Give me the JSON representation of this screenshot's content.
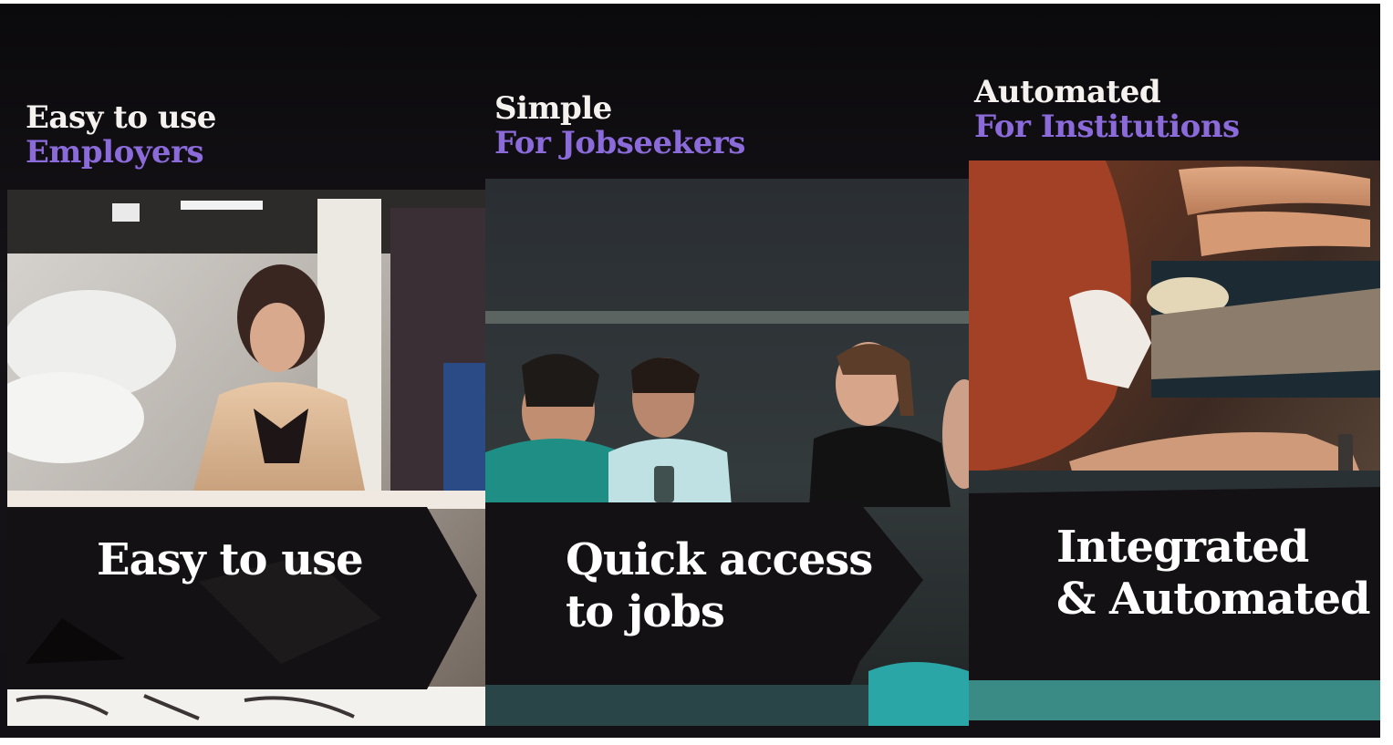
{
  "columns": [
    {
      "heading": "Easy to use",
      "audience": "Employers",
      "caption_lines": [
        "Easy to use"
      ]
    },
    {
      "heading": "Simple",
      "audience": "For Jobseekers",
      "caption_lines": [
        "Quick access",
        "to jobs"
      ]
    },
    {
      "heading": "Automated",
      "audience": "For Institutions",
      "caption_lines": [
        "Integrated",
        "& Automated"
      ]
    }
  ],
  "colors": {
    "heading": "#f4f1ee",
    "audience": "#8b6ad9",
    "background": "#141216",
    "caption_band": "#141114"
  },
  "photos": [
    {
      "subject": "woman-working-at-sewing-table-photo"
    },
    {
      "subject": "group-of-young-people-talking-photo"
    },
    {
      "subject": "hands-working-on-shoe-soles-photo"
    }
  ]
}
